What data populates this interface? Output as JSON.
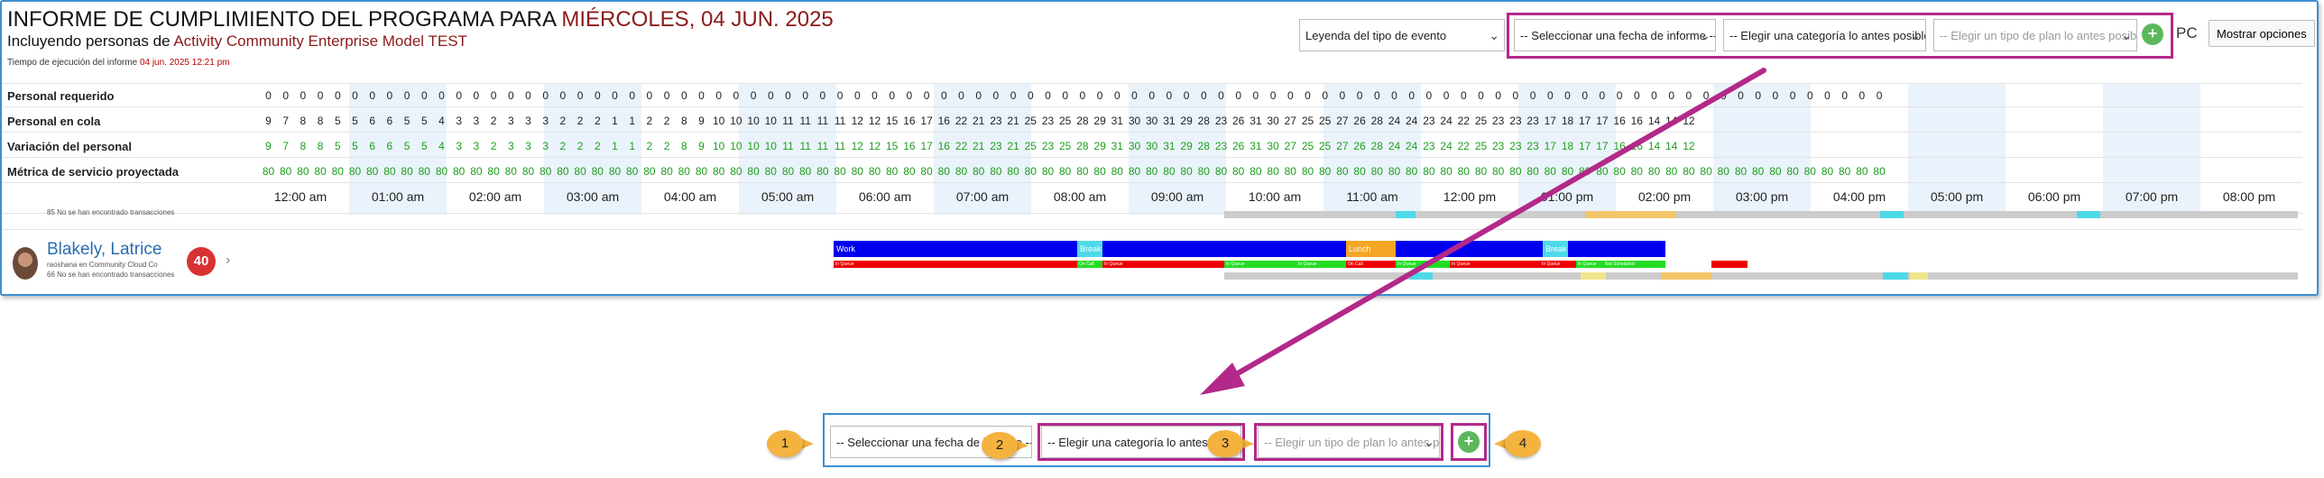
{
  "header": {
    "title_prefix": "INFORME DE CUMPLIMIENTO DEL PROGRAMA PARA ",
    "title_date": "MIÉRCOLES, 04 JUN. 2025",
    "subtitle_prefix": "Incluyendo personas de ",
    "subtitle_org": "Activity Community Enterprise Model TEST",
    "exec_label": "Tiempo de ejecución del informe",
    "exec_value": "04 jun. 2025 12:21 pm"
  },
  "toolbar": {
    "legend_select": "Leyenda del tipo de evento",
    "date_select": "-- Seleccionar una fecha de informe --",
    "category_select": "-- Elegir una categoría lo antes posible --",
    "plan_select": "-- Elegir un tipo de plan lo antes posible --",
    "add_icon": "plus-circle-icon",
    "pc_label": "PC",
    "show_options": "Mostrar opciones"
  },
  "metrics": {
    "rows": [
      {
        "label": "Personal requerido",
        "color": "#222222",
        "values": [
          0,
          0,
          0,
          0,
          0,
          0,
          0,
          0,
          0,
          0,
          0,
          0,
          0,
          0,
          0,
          0,
          0,
          0,
          0,
          0,
          0,
          0,
          0,
          0,
          0,
          0,
          0,
          0,
          0,
          0,
          0,
          0,
          0,
          0,
          0,
          0,
          0,
          0,
          0,
          0,
          0,
          0,
          0,
          0,
          0,
          0,
          0,
          0,
          0,
          0,
          0,
          0,
          0,
          0,
          0,
          0,
          0,
          0,
          0,
          0,
          0,
          0,
          0,
          0,
          0,
          0,
          0,
          0,
          0,
          0,
          0,
          0,
          0,
          0,
          0,
          0,
          0,
          0,
          0,
          0,
          0,
          0,
          0,
          0,
          0,
          0,
          0,
          0,
          0,
          0,
          0,
          0,
          0,
          0
        ]
      },
      {
        "label": "Personal en cola",
        "color": "#222222",
        "values": [
          9,
          7,
          8,
          8,
          5,
          5,
          6,
          6,
          5,
          5,
          4,
          3,
          3,
          2,
          3,
          3,
          3,
          2,
          2,
          2,
          1,
          1,
          2,
          2,
          8,
          9,
          10,
          10,
          10,
          10,
          11,
          11,
          11,
          11,
          12,
          12,
          15,
          16,
          17,
          16,
          22,
          21,
          23,
          21,
          25,
          23,
          25,
          28,
          29,
          31,
          30,
          30,
          31,
          29,
          28,
          23,
          26,
          31,
          30,
          27,
          25,
          25,
          27,
          26,
          28,
          24,
          24,
          23,
          24,
          22,
          25,
          23,
          23,
          23,
          17,
          18,
          17,
          17,
          16,
          16,
          14,
          14,
          12
        ]
      },
      {
        "label": "Variación del personal",
        "color": "#1e9e1e",
        "values": [
          9,
          7,
          8,
          8,
          5,
          5,
          6,
          6,
          5,
          5,
          4,
          3,
          3,
          2,
          3,
          3,
          3,
          2,
          2,
          2,
          1,
          1,
          2,
          2,
          8,
          9,
          10,
          10,
          10,
          10,
          11,
          11,
          11,
          11,
          12,
          12,
          15,
          16,
          17,
          16,
          22,
          21,
          23,
          21,
          25,
          23,
          25,
          28,
          29,
          31,
          30,
          30,
          31,
          29,
          28,
          23,
          26,
          31,
          30,
          27,
          25,
          25,
          27,
          26,
          28,
          24,
          24,
          23,
          24,
          22,
          25,
          23,
          23,
          23,
          17,
          18,
          17,
          17,
          16,
          16,
          14,
          14,
          12
        ]
      },
      {
        "label": "Métrica de servicio proyectada",
        "color": "#1e9e1e",
        "values": [
          80,
          80,
          80,
          80,
          80,
          80,
          80,
          80,
          80,
          80,
          80,
          80,
          80,
          80,
          80,
          80,
          80,
          80,
          80,
          80,
          80,
          80,
          80,
          80,
          80,
          80,
          80,
          80,
          80,
          80,
          80,
          80,
          80,
          80,
          80,
          80,
          80,
          80,
          80,
          80,
          80,
          80,
          80,
          80,
          80,
          80,
          80,
          80,
          80,
          80,
          80,
          80,
          80,
          80,
          80,
          80,
          80,
          80,
          80,
          80,
          80,
          80,
          80,
          80,
          80,
          80,
          80,
          80,
          80,
          80,
          80,
          80,
          80,
          80,
          80,
          80,
          80,
          80,
          80,
          80,
          80,
          80,
          80,
          80,
          80,
          80,
          80,
          80,
          80,
          80,
          80,
          80,
          80,
          80
        ]
      }
    ]
  },
  "timeline": {
    "hours": [
      "12:00 am",
      "01:00 am",
      "02:00 am",
      "03:00 am",
      "04:00 am",
      "05:00 am",
      "06:00 am",
      "07:00 am",
      "08:00 am",
      "09:00 am",
      "10:00 am",
      "11:00 am",
      "12:00 pm",
      "01:00 pm",
      "02:00 pm",
      "03:00 pm",
      "04:00 pm",
      "05:00 pm",
      "06:00 pm",
      "07:00 pm",
      "08:00 pm"
    ]
  },
  "prev_agent_note": "85 No se han encontrado transacciones",
  "agent": {
    "name": "Blakely, Latrice",
    "line1": "raoshana en Community Cloud Co",
    "line2": "66 No se han encontrado transacciones",
    "badge": "40",
    "segments": {
      "work": "Work",
      "break": "Break",
      "lunch": "Lunch",
      "small": [
        "In Queue",
        "On Call",
        "In Queue",
        "In Queue",
        "In Queue",
        "On Call",
        "In Queue",
        "In Queue",
        "In Queue",
        "In Queue",
        "Not Scheduled"
      ]
    }
  },
  "zoom": {
    "date_select": "-- Seleccionar una fecha de informe --",
    "category_select": "-- Elegir una categoría lo antes posible --",
    "plan_select": "-- Elegir un tipo de plan lo antes posible --",
    "callouts": [
      "1",
      "2",
      "3",
      "4"
    ]
  },
  "colors": {
    "accent": "#8b1a1a",
    "highlight": "#b3298a",
    "frame": "#3d8fd1",
    "callout": "#f4b23f",
    "work": "#0000ee",
    "break": "#4dd9e8",
    "lunch": "#f5a623",
    "in_queue": "#ee0000",
    "on_call": "#22dd22"
  }
}
